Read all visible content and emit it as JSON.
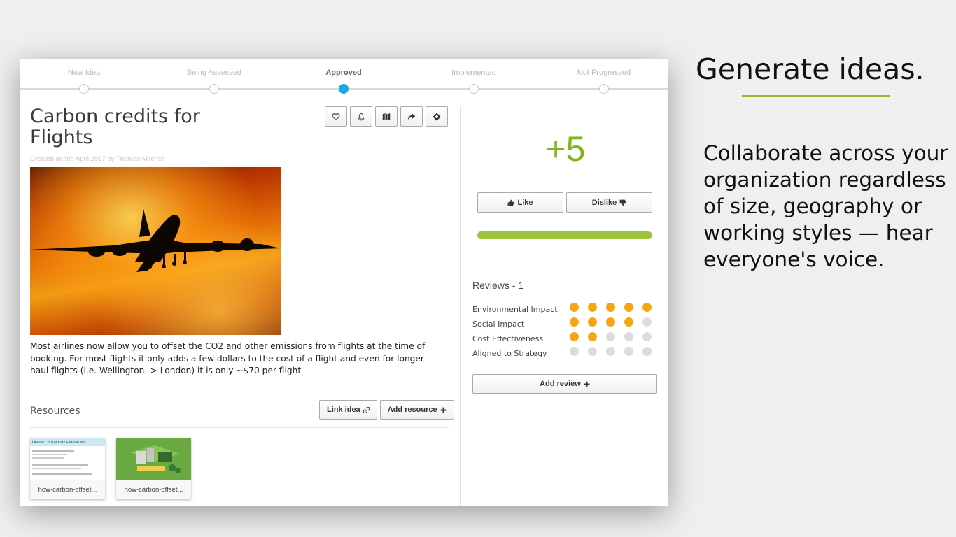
{
  "stepper": {
    "steps": [
      {
        "label": "New Idea",
        "active": false
      },
      {
        "label": "Being Assessed",
        "active": false
      },
      {
        "label": "Approved",
        "active": true
      },
      {
        "label": "Implemented",
        "active": false
      },
      {
        "label": "Not Progressed",
        "active": false
      }
    ]
  },
  "idea": {
    "title": "Carbon credits for Flights",
    "created": "Created on 9th April 2017 by Thomas Mitchell",
    "description": "Most airlines now allow you to offset the CO2 and other emissions from flights at the time of booking. For most flights it only adds a few dollars to the cost of a flight and even for longer haul flights (i.e. Wellington -> London) it is only ~$70 per flight"
  },
  "toolbar": {
    "icons": [
      "heart-icon",
      "bell-icon",
      "map-icon",
      "share-icon",
      "gear-icon"
    ]
  },
  "resources": {
    "title": "Resources",
    "link_label": "Link idea",
    "add_label": "Add resource",
    "items": [
      {
        "caption": "how-carbon-offset..."
      },
      {
        "caption": "how-carbon-offset..."
      }
    ],
    "thumb1_heading": "OFFSET YOUR CO2 EMISSIONS"
  },
  "voting": {
    "score": "+5",
    "like_label": "Like",
    "dislike_label": "Dislike",
    "bar_fraction": 1.0,
    "bar_color": "#9dc43a"
  },
  "reviews": {
    "title": "Reviews - 1",
    "criteria": [
      {
        "name": "Environmental Impact",
        "rating": 5
      },
      {
        "name": "Social Impact",
        "rating": 4
      },
      {
        "name": "Cost Effectiveness",
        "rating": 2
      },
      {
        "name": "Aligned to Strategy",
        "rating": 0
      }
    ],
    "max_rating": 5,
    "add_label": "Add review"
  },
  "marketing": {
    "headline": "Generate ideas.",
    "body": "Collaborate across your organization regardless of size, geography or working styles — hear everyone's voice."
  },
  "colors": {
    "accent_blue": "#17a9ec",
    "score_green": "#7cb81b",
    "rating_orange": "#f5a613",
    "underline_green": "#98b92c"
  }
}
